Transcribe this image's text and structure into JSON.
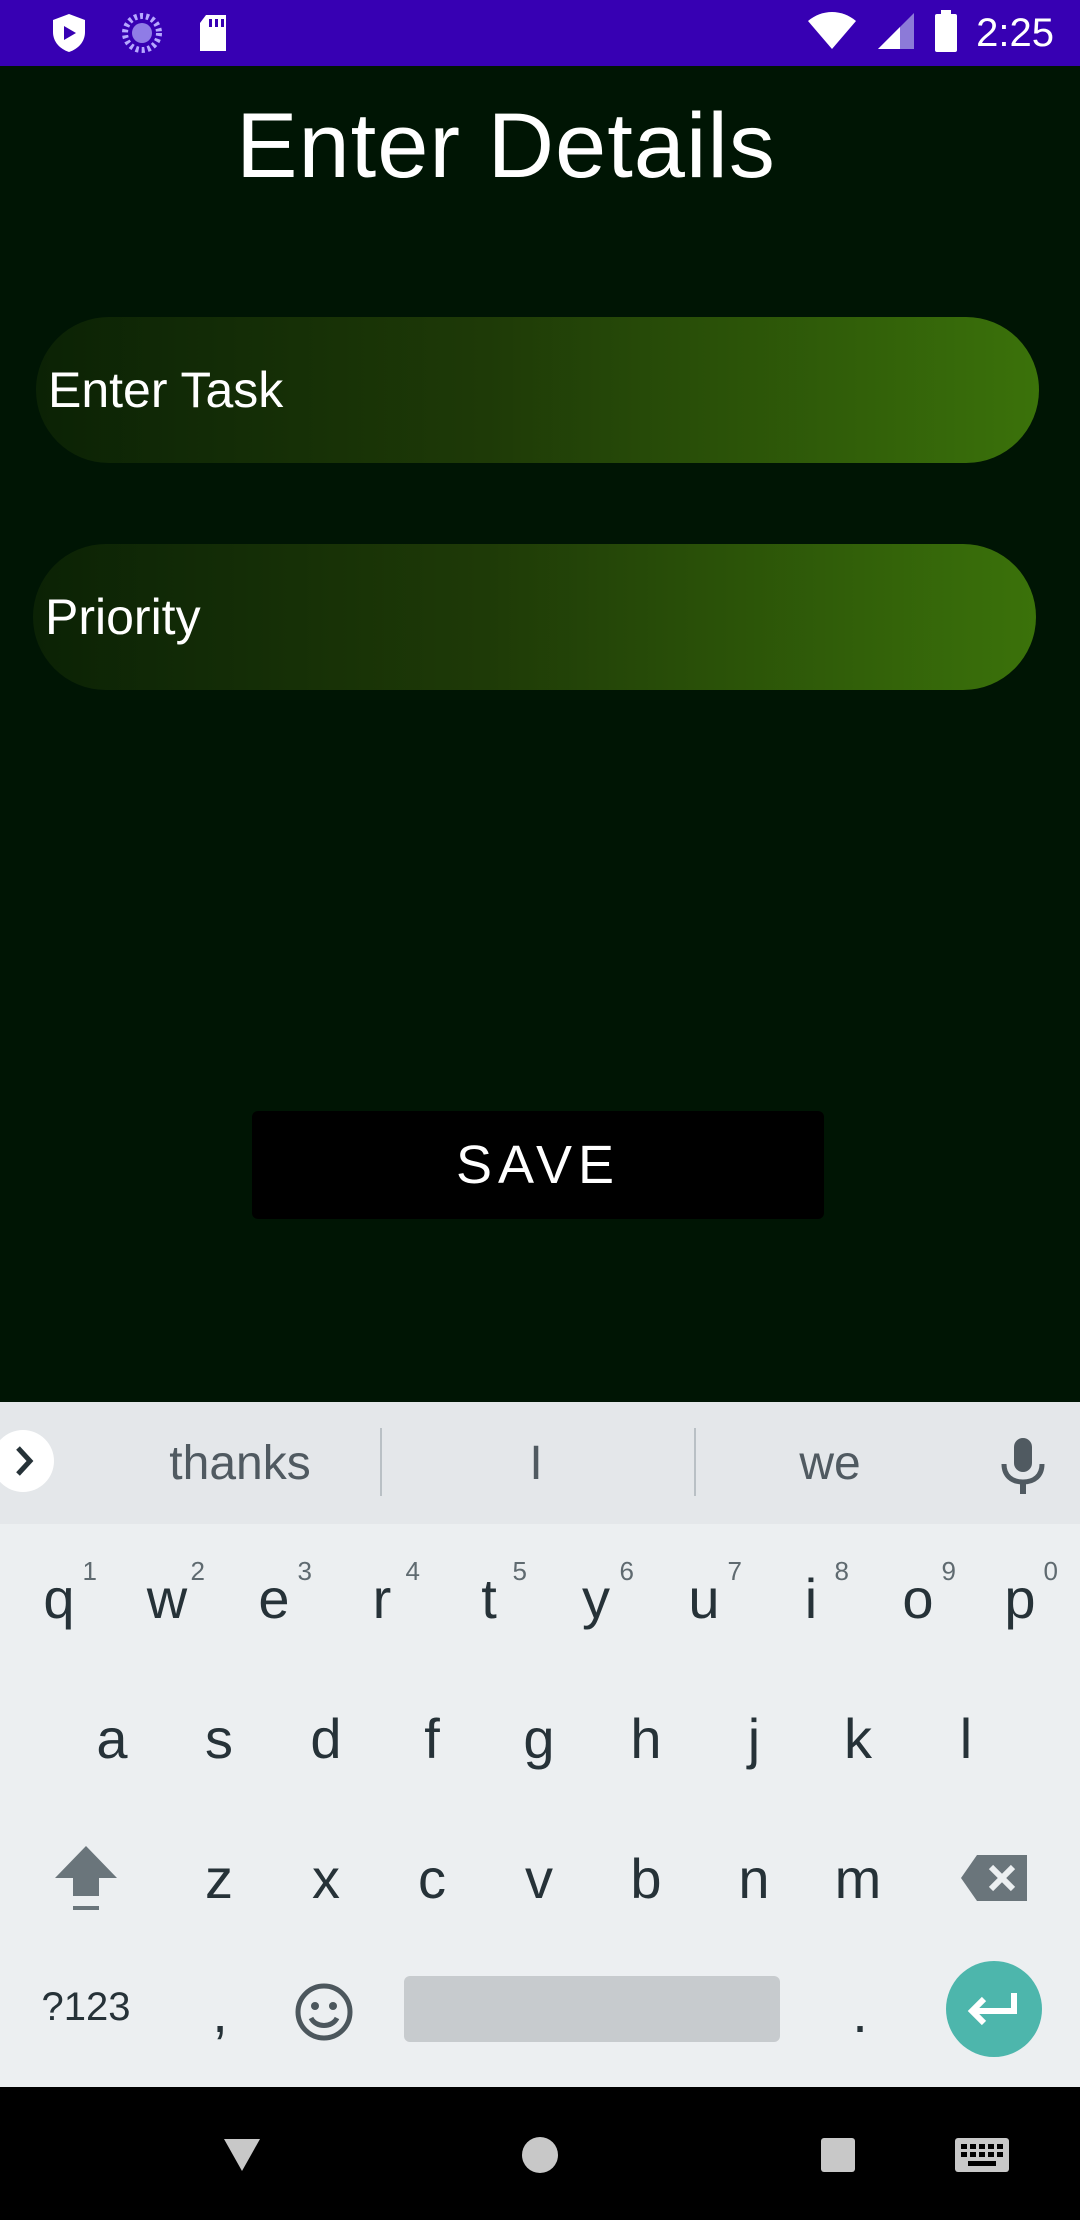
{
  "status_bar": {
    "time": "2:25",
    "icons": [
      "shield-icon",
      "loading-icon",
      "sd-card-icon",
      "wifi-icon",
      "signal-icon",
      "battery-icon"
    ]
  },
  "app": {
    "title": "Enter Details",
    "task_field": {
      "placeholder": "Enter Task",
      "value": ""
    },
    "priority_field": {
      "placeholder": "Priority",
      "value": ""
    },
    "save_label": "SAVE",
    "colors": {
      "background": "#001504",
      "field_end": "#3b720a",
      "status_bar": "#3700B3"
    }
  },
  "keyboard": {
    "suggestions": [
      "thanks",
      "I",
      "we"
    ],
    "row1": [
      {
        "key": "q",
        "hint": "1"
      },
      {
        "key": "w",
        "hint": "2"
      },
      {
        "key": "e",
        "hint": "3"
      },
      {
        "key": "r",
        "hint": "4"
      },
      {
        "key": "t",
        "hint": "5"
      },
      {
        "key": "y",
        "hint": "6"
      },
      {
        "key": "u",
        "hint": "7"
      },
      {
        "key": "i",
        "hint": "8"
      },
      {
        "key": "o",
        "hint": "9"
      },
      {
        "key": "p",
        "hint": "0"
      }
    ],
    "row2": [
      "a",
      "s",
      "d",
      "f",
      "g",
      "h",
      "j",
      "k",
      "l"
    ],
    "row3": [
      "z",
      "x",
      "c",
      "v",
      "b",
      "n",
      "m"
    ],
    "symbols_label": "?123",
    "comma": ",",
    "period": "."
  },
  "nav_bar": {
    "items": [
      "back-icon",
      "home-icon",
      "recents-icon",
      "keyboard-switch-icon"
    ]
  }
}
